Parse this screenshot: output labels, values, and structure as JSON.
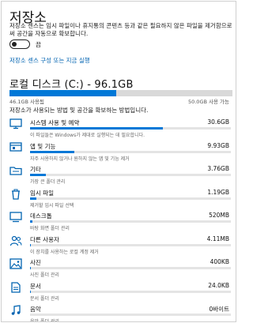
{
  "page": {
    "title": "저장소",
    "description": "저장소 센스는 임시 파일이나 휴지통의 콘텐츠 등과 같은 필요하지 않은 파일을 제거함으로써 공간을 자동으로 확보합니다.",
    "toggle_label": "끔",
    "toggle_on": false,
    "configure_link": "저장소 센스 구성 또는 지금 실행"
  },
  "drive": {
    "title": "로컬 디스크 (C:) - 96.1GB",
    "used_label": "46.1GB 사용됨",
    "free_label": "50.0GB 사용 가능",
    "used_fraction": 0.48
  },
  "intro": "저장소가 사용되는 방법 및 공간을 확보하는 방법입니다.",
  "categories": [
    {
      "icon": "monitor-icon",
      "name": "시스템 사용 및 예약",
      "size": "30.6GB",
      "fraction": 0.66,
      "sub": "이 파일들은 Windows가 제대로 실행되는 데 필요합니다."
    },
    {
      "icon": "apps-icon",
      "name": "앱 및 기능",
      "size": "9.93GB",
      "fraction": 0.22,
      "sub": "자주 사용하지 않거나 원하지 않는 앱 및 기능 제거"
    },
    {
      "icon": "folder-icon",
      "name": "기타",
      "size": "3.76GB",
      "fraction": 0.08,
      "sub": "가장 큰 폴더 관리"
    },
    {
      "icon": "trash-icon",
      "name": "임시 파일",
      "size": "1.19GB",
      "fraction": 0.03,
      "sub": "제거할 임시 파일 선택"
    },
    {
      "icon": "desktop-icon",
      "name": "데스크톱",
      "size": "520MB",
      "fraction": 0.012,
      "sub": "바탕 화면 폴더 관리"
    },
    {
      "icon": "users-icon",
      "name": "다른 사용자",
      "size": "4.11MB",
      "fraction": 0.004,
      "sub": "이 장치를 사용하는 로컬 계정 제거"
    },
    {
      "icon": "image-icon",
      "name": "사진",
      "size": "400KB",
      "fraction": 0.003,
      "sub": "사진 폴더 관리"
    },
    {
      "icon": "document-icon",
      "name": "문서",
      "size": "24.0KB",
      "fraction": 0.002,
      "sub": "문서 폴더 관리"
    },
    {
      "icon": "music-icon",
      "name": "음악",
      "size": "0바이트",
      "fraction": 0,
      "sub": "음악 폴더 관리"
    }
  ]
}
